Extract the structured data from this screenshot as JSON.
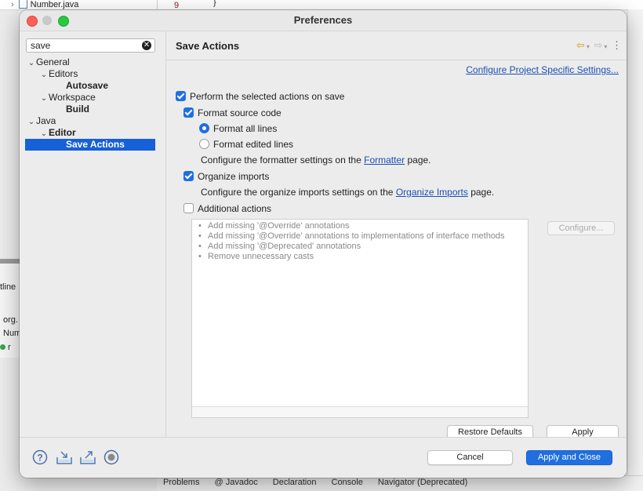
{
  "background": {
    "editor_tab": "Number.java",
    "line_number": "9",
    "line_code": "}",
    "left_panel_lines": [
      "tline",
      "org.",
      "Num",
      "r"
    ],
    "bottom_tabs": [
      "Problems",
      "@ Javadoc",
      "Declaration",
      "Console",
      "Navigator (Deprecated)"
    ]
  },
  "dialog": {
    "title": "Preferences",
    "filter": {
      "value": "save"
    },
    "tree": [
      {
        "label": "General",
        "level": 0,
        "expanded": true,
        "bold": false
      },
      {
        "label": "Editors",
        "level": 1,
        "expanded": true,
        "bold": false
      },
      {
        "label": "Autosave",
        "level": 2,
        "bold": true
      },
      {
        "label": "Workspace",
        "level": 1,
        "expanded": true,
        "bold": false
      },
      {
        "label": "Build",
        "level": 2,
        "bold": true
      },
      {
        "label": "Java",
        "level": 0,
        "expanded": true,
        "bold": false
      },
      {
        "label": "Editor",
        "level": 1,
        "expanded": true,
        "bold": true
      },
      {
        "label": "Save Actions",
        "level": 2,
        "bold": true,
        "selected": true
      }
    ],
    "page": {
      "title": "Save Actions",
      "configure_project_link": "Configure Project Specific Settings...",
      "perform_on_save": {
        "label": "Perform the selected actions on save",
        "checked": true
      },
      "format_source": {
        "label": "Format source code",
        "checked": true
      },
      "format_all": {
        "label": "Format all lines",
        "selected": true
      },
      "format_edited": {
        "label": "Format edited lines",
        "selected": false
      },
      "formatter_text_before": "Configure the formatter settings on the ",
      "formatter_link": "Formatter",
      "formatter_text_after": " page.",
      "organize_imports": {
        "label": "Organize imports",
        "checked": true
      },
      "organize_text_before": "Configure the organize imports settings on the ",
      "organize_link": "Organize Imports",
      "organize_text_after": " page.",
      "additional_actions": {
        "label": "Additional actions",
        "checked": false
      },
      "actions_list": [
        "Add missing '@Override' annotations",
        "Add missing '@Override' annotations to implementations of interface methods",
        "Add missing '@Deprecated' annotations",
        "Remove unnecessary casts"
      ],
      "configure_button": "Configure...",
      "restore_defaults": "Restore Defaults",
      "apply": "Apply"
    },
    "footer": {
      "cancel": "Cancel",
      "apply_close": "Apply and Close",
      "icons": [
        "help-icon",
        "import-icon",
        "export-icon",
        "record-icon"
      ]
    }
  },
  "colors": {
    "accent": "#1f6fe0",
    "selection": "#1660d8",
    "link": "#1a4fb5",
    "nav_arrow": "#d49b00"
  }
}
